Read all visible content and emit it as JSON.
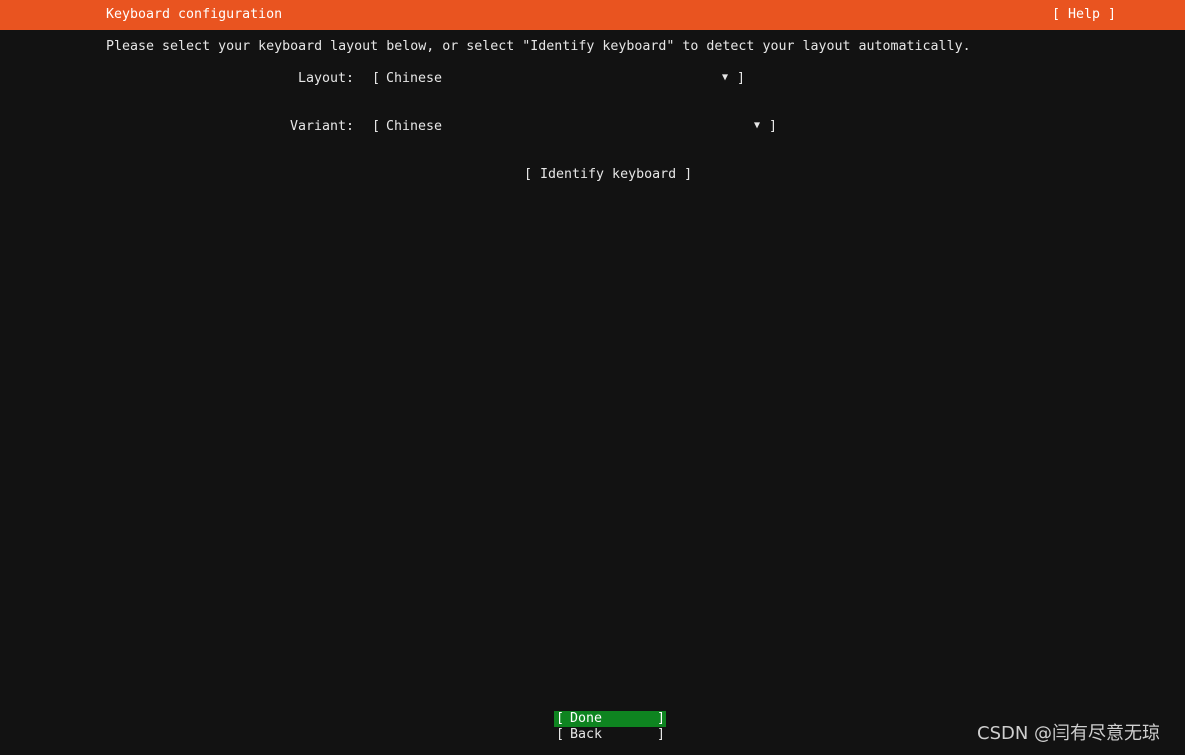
{
  "header": {
    "title": "Keyboard configuration",
    "help_label": "[ Help ]"
  },
  "intro_text": "Please select your keyboard layout below, or select \"Identify keyboard\" to detect your layout automatically.",
  "layout_field": {
    "label": "Layout:",
    "open_bracket": "[",
    "value": "Chinese",
    "dropdown_icon": "▼",
    "close_bracket": "]"
  },
  "variant_field": {
    "label": "Variant:",
    "open_bracket": "[",
    "value": "Chinese",
    "dropdown_icon": "▼",
    "close_bracket": "]"
  },
  "identify_button": "[ Identify keyboard ]",
  "buttons": {
    "done": {
      "open": "[",
      "label": "Done",
      "close": "]"
    },
    "back": {
      "open": "[",
      "label": "Back",
      "close": "]"
    }
  },
  "watermark": "CSDN @闫有尽意无琼",
  "colors": {
    "header_bg": "#e95420",
    "focus_bg": "#0e8420",
    "page_bg": "#121212"
  }
}
